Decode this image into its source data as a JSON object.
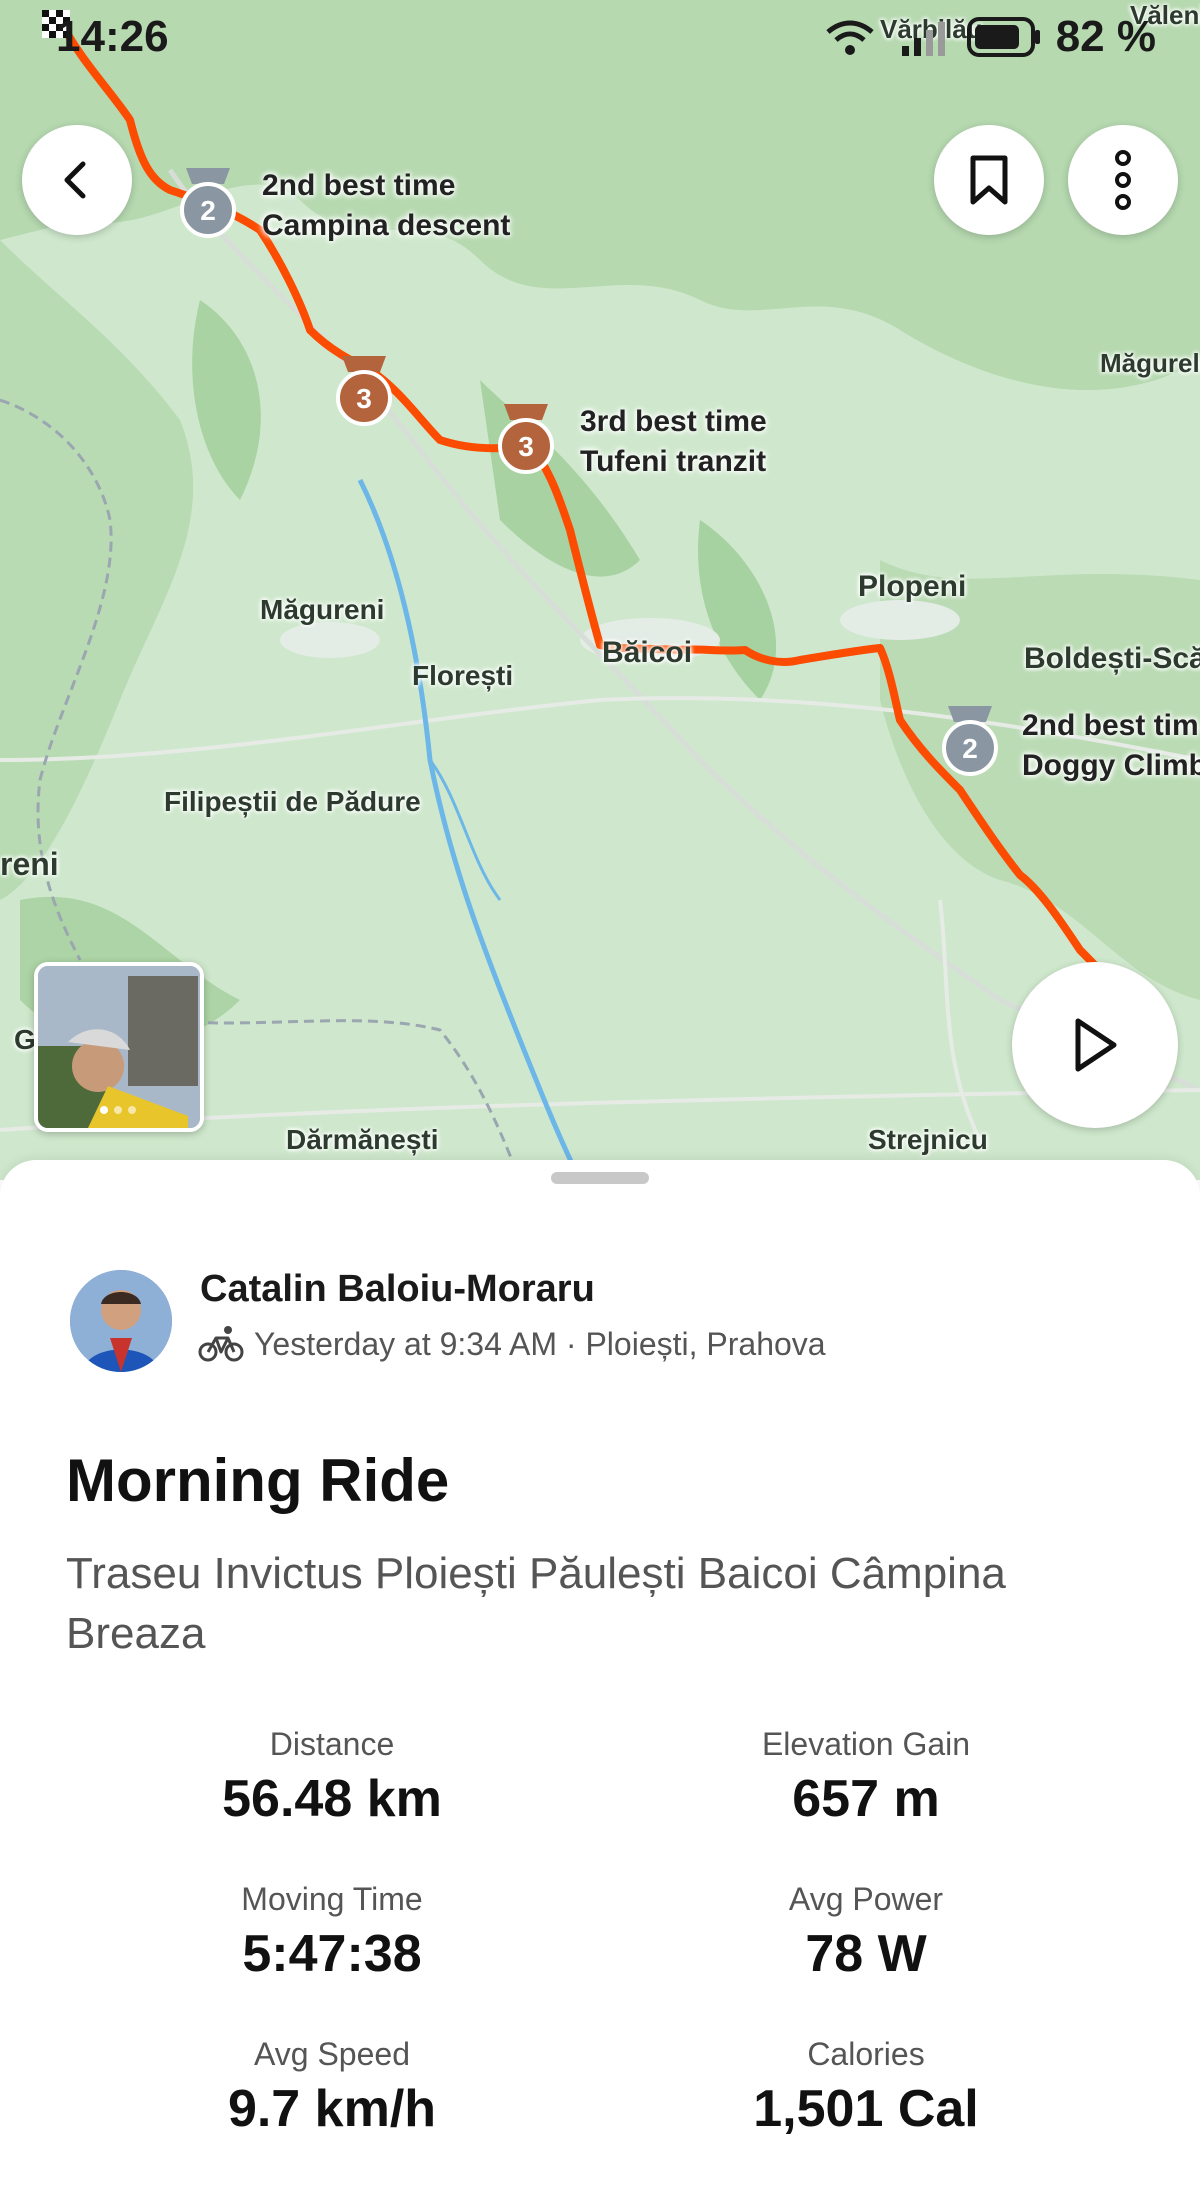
{
  "status_bar": {
    "time": "14:26",
    "battery": "82 %"
  },
  "map": {
    "places": [
      "Vălenii de Munte",
      "Vărbilău",
      "Măgurele",
      "Măgureni",
      "Florești",
      "Băicoi",
      "Plopeni",
      "Boldești-Scăeni",
      "Filipeștii de Pădure",
      "reni",
      "G",
      "Dărmănești",
      "Strejnicu"
    ],
    "segments": [
      {
        "rank": "2",
        "line1": "2nd best time",
        "line2": "Campina descent"
      },
      {
        "rank": "3"
      },
      {
        "rank": "3",
        "line1": "3rd best time",
        "line2": "Tufeni tranzit"
      },
      {
        "rank": "2",
        "line1": "2nd best tim",
        "line2": "Doggy Climb"
      }
    ],
    "route_color": "#FC4C02"
  },
  "buttons": {
    "back": "back",
    "save": "bookmark",
    "more": "more",
    "play": "play"
  },
  "activity": {
    "athlete": "Catalin Baloiu-Moraru",
    "meta": "Yesterday at 9:34 AM · Ploiești, Prahova",
    "sport_icon": "bike-icon",
    "title": "Morning Ride",
    "description": "Traseu Invictus Ploiești Păulești Baicoi Câmpina Breaza"
  },
  "stats": [
    {
      "label": "Distance",
      "value": "56.48 km"
    },
    {
      "label": "Elevation Gain",
      "value": "657 m"
    },
    {
      "label": "Moving Time",
      "value": "5:47:38"
    },
    {
      "label": "Avg Power",
      "value": "78 W"
    },
    {
      "label": "Avg Speed",
      "value": "9.7 km/h"
    },
    {
      "label": "Calories",
      "value": "1,501 Cal"
    }
  ]
}
